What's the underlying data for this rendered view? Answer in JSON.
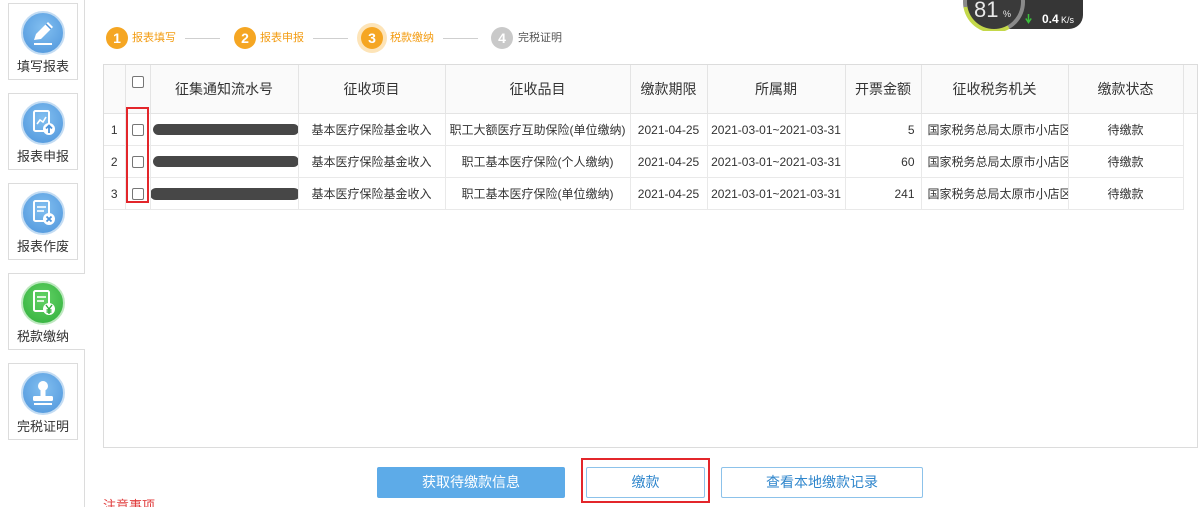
{
  "sidebar": {
    "items": [
      {
        "label": "填写报表",
        "icon": "pencil-icon",
        "active": false
      },
      {
        "label": "报表申报",
        "icon": "report-upload-icon",
        "active": false
      },
      {
        "label": "报表作废",
        "icon": "report-void-icon",
        "active": false
      },
      {
        "label": "税款缴纳",
        "icon": "tax-payment-icon",
        "active": true
      },
      {
        "label": "完税证明",
        "icon": "stamp-icon",
        "active": false
      }
    ]
  },
  "steps": [
    {
      "number": "1",
      "label": "报表填写",
      "completed": true,
      "current": false
    },
    {
      "number": "2",
      "label": "报表申报",
      "completed": true,
      "current": false
    },
    {
      "number": "3",
      "label": "税款缴纳",
      "completed": false,
      "current": true
    },
    {
      "number": "4",
      "label": "完税证明",
      "completed": false,
      "current": false
    }
  ],
  "table": {
    "select_all_checked": false,
    "headers": [
      "征集通知流水号",
      "征收项目",
      "征收品目",
      "缴款期限",
      "所属期",
      "开票金额",
      "征收税务机关",
      "缴款状态"
    ],
    "rows": [
      {
        "index": "1",
        "checked": false,
        "serial_redacted": true,
        "item": "基本医疗保险基金收入",
        "subitem": "职工大额医疗互助保险(单位缴纳)",
        "deadline": "2021-04-25",
        "period": "2021-03-01~2021-03-31",
        "amount": "5",
        "authority": "国家税务总局太原市小店区税",
        "status": "待缴款"
      },
      {
        "index": "2",
        "checked": false,
        "serial_redacted": true,
        "item": "基本医疗保险基金收入",
        "subitem": "职工基本医疗保险(个人缴纳)",
        "deadline": "2021-04-25",
        "period": "2021-03-01~2021-03-31",
        "amount": "60",
        "authority": "国家税务总局太原市小店区税",
        "status": "待缴款"
      },
      {
        "index": "3",
        "checked": false,
        "serial_redacted": true,
        "item": "基本医疗保险基金收入",
        "subitem": "职工基本医疗保险(单位缴纳)",
        "deadline": "2021-04-25",
        "period": "2021-03-01~2021-03-31",
        "amount": "241",
        "authority": "国家税务总局太原市小店区税",
        "status": "待缴款"
      }
    ]
  },
  "actions": {
    "fetch_label": "获取待缴款信息",
    "pay_label": "缴款",
    "history_label": "查看本地缴款记录"
  },
  "notice": {
    "title": "注意事项"
  },
  "speed_widget": {
    "percent": "81",
    "percent_sign": "%",
    "icon": "download-arrow-icon",
    "speed": "0.4",
    "unit": "K/s"
  },
  "colors": {
    "accent_blue": "#5dabe8",
    "step_orange": "#f5a623",
    "active_green": "#2fae3a",
    "highlight_red": "#e3262b",
    "pending_gray": "#c9c9c9"
  }
}
